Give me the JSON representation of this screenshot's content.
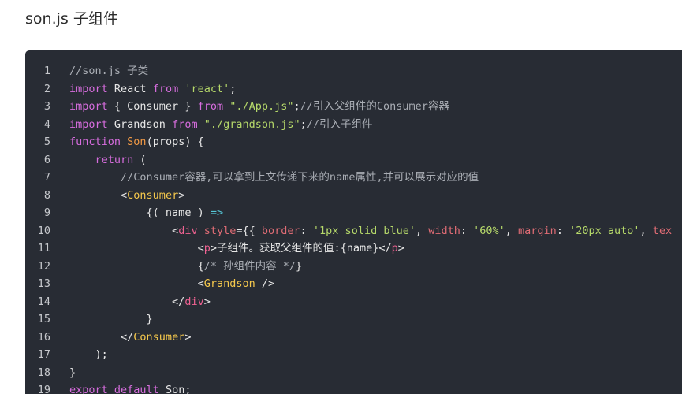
{
  "page": {
    "title": "son.js 子组件"
  },
  "code": {
    "lines": [
      {
        "num": "1",
        "tokens": [
          {
            "t": "//son.js 子类",
            "c": "comment"
          }
        ]
      },
      {
        "num": "2",
        "tokens": [
          {
            "t": "import",
            "c": "keyword"
          },
          {
            "t": " React ",
            "c": "plain"
          },
          {
            "t": "from",
            "c": "keyword"
          },
          {
            "t": " ",
            "c": "plain"
          },
          {
            "t": "'react'",
            "c": "string"
          },
          {
            "t": ";",
            "c": "punct"
          }
        ]
      },
      {
        "num": "3",
        "tokens": [
          {
            "t": "import",
            "c": "keyword"
          },
          {
            "t": " { Consumer } ",
            "c": "plain"
          },
          {
            "t": "from",
            "c": "keyword"
          },
          {
            "t": " ",
            "c": "plain"
          },
          {
            "t": "\"./App.js\"",
            "c": "string"
          },
          {
            "t": ";",
            "c": "punct"
          },
          {
            "t": "//引入父组件的Consumer容器",
            "c": "comment"
          }
        ]
      },
      {
        "num": "4",
        "tokens": [
          {
            "t": "import",
            "c": "keyword"
          },
          {
            "t": " Grandson ",
            "c": "plain"
          },
          {
            "t": "from",
            "c": "keyword"
          },
          {
            "t": " ",
            "c": "plain"
          },
          {
            "t": "\"./grandson.js\"",
            "c": "string"
          },
          {
            "t": ";",
            "c": "punct"
          },
          {
            "t": "//引入子组件",
            "c": "comment"
          }
        ]
      },
      {
        "num": "5",
        "tokens": [
          {
            "t": "function",
            "c": "keyword"
          },
          {
            "t": " ",
            "c": "plain"
          },
          {
            "t": "Son",
            "c": "func"
          },
          {
            "t": "(props) {",
            "c": "plain"
          }
        ]
      },
      {
        "num": "6",
        "tokens": [
          {
            "t": "    ",
            "c": "plain"
          },
          {
            "t": "return",
            "c": "keyword"
          },
          {
            "t": " (",
            "c": "plain"
          }
        ]
      },
      {
        "num": "7",
        "tokens": [
          {
            "t": "        ",
            "c": "plain"
          },
          {
            "t": "//Consumer容器,可以拿到上文传递下来的name属性,并可以展示对应的值",
            "c": "comment"
          }
        ]
      },
      {
        "num": "8",
        "tokens": [
          {
            "t": "        ",
            "c": "plain"
          },
          {
            "t": "<",
            "c": "punct"
          },
          {
            "t": "Consumer",
            "c": "comp"
          },
          {
            "t": ">",
            "c": "punct"
          }
        ]
      },
      {
        "num": "9",
        "tokens": [
          {
            "t": "            ",
            "c": "plain"
          },
          {
            "t": "{( name ) ",
            "c": "plain"
          },
          {
            "t": "=>",
            "c": "arrow"
          }
        ]
      },
      {
        "num": "10",
        "tokens": [
          {
            "t": "                ",
            "c": "plain"
          },
          {
            "t": "<",
            "c": "punct"
          },
          {
            "t": "div",
            "c": "tag"
          },
          {
            "t": " ",
            "c": "plain"
          },
          {
            "t": "style",
            "c": "attr"
          },
          {
            "t": "={{ ",
            "c": "plain"
          },
          {
            "t": "border",
            "c": "attr"
          },
          {
            "t": ": ",
            "c": "plain"
          },
          {
            "t": "'1px solid blue'",
            "c": "string"
          },
          {
            "t": ", ",
            "c": "plain"
          },
          {
            "t": "width",
            "c": "attr"
          },
          {
            "t": ": ",
            "c": "plain"
          },
          {
            "t": "'60%'",
            "c": "string"
          },
          {
            "t": ", ",
            "c": "plain"
          },
          {
            "t": "margin",
            "c": "attr"
          },
          {
            "t": ": ",
            "c": "plain"
          },
          {
            "t": "'20px auto'",
            "c": "string"
          },
          {
            "t": ", ",
            "c": "plain"
          },
          {
            "t": "tex",
            "c": "attr"
          }
        ]
      },
      {
        "num": "11",
        "tokens": [
          {
            "t": "                    ",
            "c": "plain"
          },
          {
            "t": "<",
            "c": "punct"
          },
          {
            "t": "p",
            "c": "tag"
          },
          {
            "t": ">",
            "c": "punct"
          },
          {
            "t": "子组件。获取父组件的值:{name}",
            "c": "plain"
          },
          {
            "t": "</",
            "c": "punct"
          },
          {
            "t": "p",
            "c": "tag"
          },
          {
            "t": ">",
            "c": "punct"
          }
        ]
      },
      {
        "num": "12",
        "tokens": [
          {
            "t": "                    ",
            "c": "plain"
          },
          {
            "t": "{",
            "c": "plain"
          },
          {
            "t": "/* 孙组件内容 */",
            "c": "comment"
          },
          {
            "t": "}",
            "c": "plain"
          }
        ]
      },
      {
        "num": "13",
        "tokens": [
          {
            "t": "                    ",
            "c": "plain"
          },
          {
            "t": "<",
            "c": "punct"
          },
          {
            "t": "Grandson",
            "c": "comp"
          },
          {
            "t": " />",
            "c": "punct"
          }
        ]
      },
      {
        "num": "14",
        "tokens": [
          {
            "t": "                ",
            "c": "plain"
          },
          {
            "t": "</",
            "c": "punct"
          },
          {
            "t": "div",
            "c": "tag"
          },
          {
            "t": ">",
            "c": "punct"
          }
        ]
      },
      {
        "num": "15",
        "tokens": [
          {
            "t": "            ",
            "c": "plain"
          },
          {
            "t": "}",
            "c": "plain"
          }
        ]
      },
      {
        "num": "16",
        "tokens": [
          {
            "t": "        ",
            "c": "plain"
          },
          {
            "t": "</",
            "c": "punct"
          },
          {
            "t": "Consumer",
            "c": "comp"
          },
          {
            "t": ">",
            "c": "punct"
          }
        ]
      },
      {
        "num": "17",
        "tokens": [
          {
            "t": "    );",
            "c": "plain"
          }
        ]
      },
      {
        "num": "18",
        "tokens": [
          {
            "t": "}",
            "c": "plain"
          }
        ]
      },
      {
        "num": "19",
        "tokens": [
          {
            "t": "export",
            "c": "keyword"
          },
          {
            "t": " ",
            "c": "plain"
          },
          {
            "t": "default",
            "c": "keyword"
          },
          {
            "t": " Son;",
            "c": "plain"
          }
        ]
      }
    ]
  },
  "colors": {
    "code_background": "#282c34",
    "comment": "#a9adb4",
    "keyword": "#d76dde",
    "string": "#b6d96a",
    "function": "#f39a45",
    "tag": "#f06292",
    "component": "#f5c84c"
  }
}
